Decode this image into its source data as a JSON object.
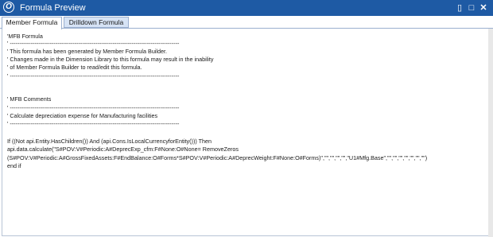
{
  "window": {
    "title": "Formula Preview",
    "app_icon_glyph": "O",
    "controls": {
      "restore_glyph": "▯",
      "maximize_glyph": "□",
      "close_glyph": "✕"
    }
  },
  "tabs": [
    {
      "label": "Member Formula",
      "active": true
    },
    {
      "label": "Drilldown Formula",
      "active": false
    }
  ],
  "code_lines": [
    "'MFB Formula",
    "' -----------------------------------------------------------------------------------------",
    "' This formula has been generated by Member Formula Builder.",
    "' Changes made in the Dimension Library to this formula may result in the inability",
    "' of Member Formula Builder to read/edit this formula.",
    "' -----------------------------------------------------------------------------------------",
    "",
    "' MFB Comments",
    "' -----------------------------------------------------------------------------------------",
    "' Calculate depreciation expense for Manufacturing facilities",
    "' -----------------------------------------------------------------------------------------",
    "",
    "If ((Not api.Entity.HasChildren()) And (api.Cons.IsLocalCurrencyforEntity())) Then",
    "api.data.calculate(\"S#POV:V#Periodic:A#DeprecExp_cfm:F#None:O#None= RemoveZeros",
    "(S#POV:V#Periodic:A#GrossFixedAssets:F#EndBalance:O#Forms*S#POV:V#Periodic:A#DeprecWeight:F#None:O#Forms)\",\"\",\"\",\"\",\"\",\"U1#Mfg.Base\",\"\",\"\",\"\",\"\",\"\",\"\",\"\")",
    "end if"
  ],
  "colors": {
    "titlebar": "#1e5aa4",
    "tab_inactive": "#d6e3f5"
  }
}
